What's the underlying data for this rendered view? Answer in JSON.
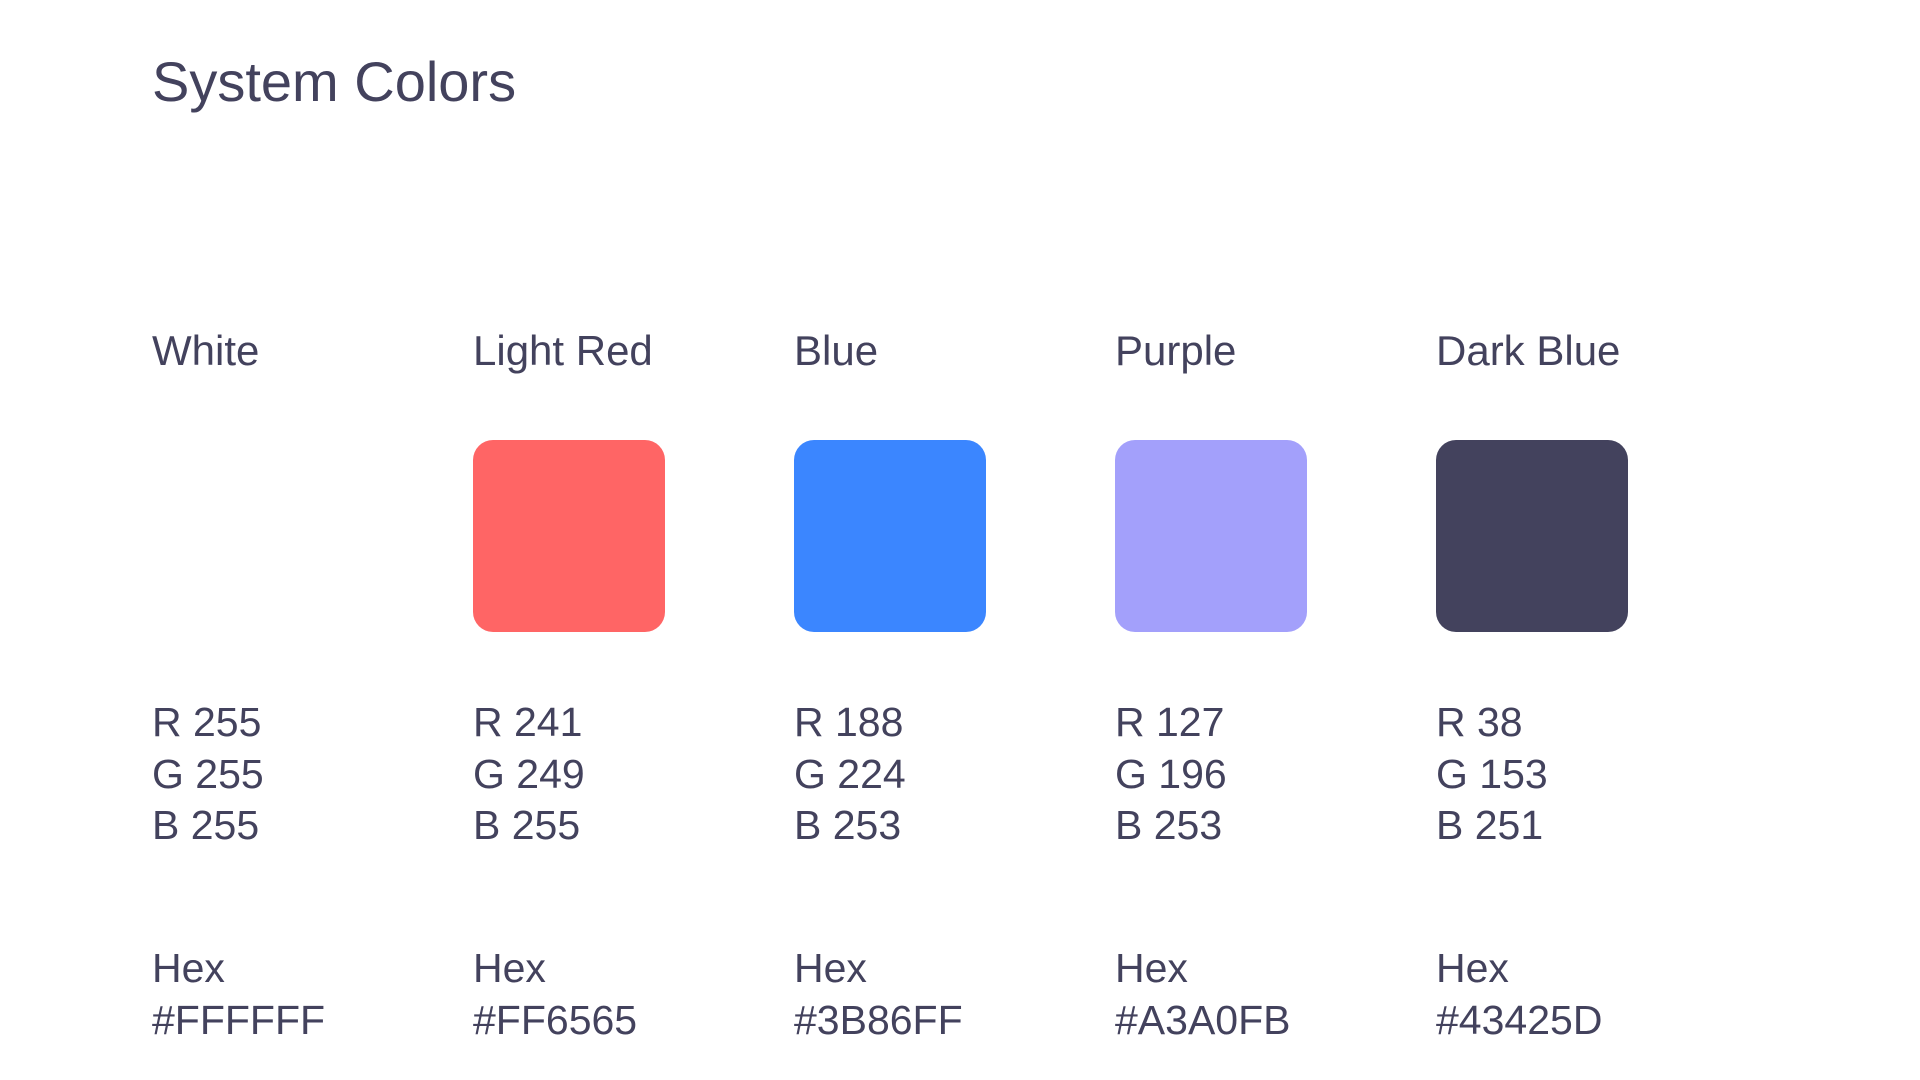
{
  "title": "System Colors",
  "hex_label": "Hex",
  "colors": [
    {
      "name": "White",
      "r": "R 255",
      "g": "G 255",
      "b": "B 255",
      "hex": "#FFFFFF",
      "swatch": "#FFFFFF"
    },
    {
      "name": "Light Red",
      "r": "R 241",
      "g": "G 249",
      "b": "B 255",
      "hex": "#FF6565",
      "swatch": "#FF6565"
    },
    {
      "name": "Blue",
      "r": "R 188",
      "g": "G 224",
      "b": "B 253",
      "hex": "#3B86FF",
      "swatch": "#3B86FF"
    },
    {
      "name": "Purple",
      "r": "R 127",
      "g": "G 196",
      "b": "B 253",
      "hex": "#A3A0FB",
      "swatch": "#A3A0FB"
    },
    {
      "name": "Dark Blue",
      "r": "R 38",
      "g": "G 153",
      "b": "B 251",
      "hex": "#43425D",
      "swatch": "#43425D"
    }
  ]
}
